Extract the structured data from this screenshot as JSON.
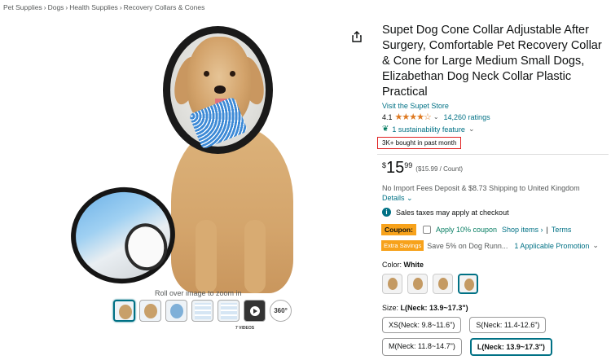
{
  "breadcrumb": {
    "items": [
      "Pet Supplies",
      "Dogs",
      "Health Supplies",
      "Recovery Collars & Cones"
    ],
    "separator": "›"
  },
  "gallery": {
    "zoom_hint": "Roll over image to zoom in",
    "videos_label": "7 VIDEOS",
    "three60_label": "360°"
  },
  "product": {
    "title": "Supet Dog Cone Collar Adjustable After Surgery, Comfortable Pet Recovery Collar & Cone for Large Medium Small Dogs, Elizabethan Dog Neck Collar Plastic Practical",
    "store_link": "Visit the Supet Store",
    "rating": "4.1",
    "stars": "★★★★☆",
    "ratings_count": "14,260 ratings",
    "sustainability": "1 sustainability feature",
    "bought": "3K+ bought in past month"
  },
  "price": {
    "symbol": "$",
    "whole": "15",
    "fraction": "99",
    "unit": "($15.99 / Count)",
    "import_text": "No Import Fees Deposit & $8.73 Shipping to United Kingdom",
    "details": "Details",
    "tax": "Sales taxes may apply at checkout"
  },
  "coupon": {
    "badge": "Coupon:",
    "text": "Apply 10% coupon",
    "shop_items": "Shop items ›",
    "terms": "Terms",
    "separator": "|"
  },
  "extra": {
    "badge": "Extra Savings",
    "text": "Save 5% on Dog Runn...",
    "promo": "1 Applicable Promotion"
  },
  "color": {
    "label": "Color:",
    "value": "White"
  },
  "size": {
    "label": "Size:",
    "value": "L(Neck: 13.9~17.3\")",
    "options": [
      "XS(Neck: 9.8~11.6\")",
      "S(Neck: 11.4-12.6\")",
      "M(Neck: 11.8~14.7\")",
      "L(Neck: 13.9~17.3\")"
    ]
  },
  "colors": {
    "accent_link": "#007185",
    "star": "#de7921",
    "coupon_badge": "#f7a21b",
    "highlight_box": "#e02020"
  }
}
